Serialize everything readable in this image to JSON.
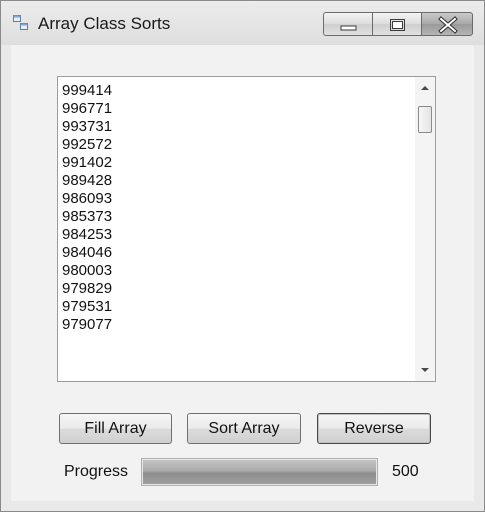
{
  "window": {
    "title": "Array Class Sorts",
    "icon": "app-window-icon",
    "controls": [
      "minimize-icon",
      "maximize-icon",
      "close-icon"
    ]
  },
  "list": {
    "items": [
      "999414",
      "996771",
      "993731",
      "992572",
      "991402",
      "989428",
      "986093",
      "985373",
      "984253",
      "984046",
      "980003",
      "979829",
      "979531",
      "979077"
    ]
  },
  "buttons": {
    "fill_label": "Fill Array",
    "sort_label": "Sort Array",
    "reverse_label": "Reverse"
  },
  "progress": {
    "label": "Progress",
    "value_text": "500",
    "fraction": 1.0
  },
  "colors": {
    "window_bg": "#f2f2f2",
    "progress_fill": "#a9a9a9"
  }
}
